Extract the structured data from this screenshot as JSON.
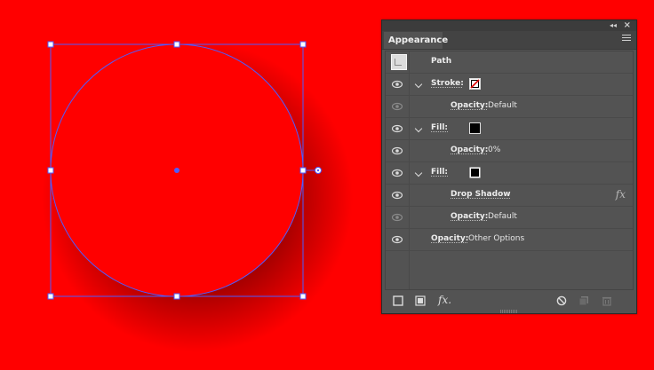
{
  "panel": {
    "title": "Appearance",
    "collapse_glyph": "◂◂",
    "close_glyph": "×",
    "menu_icon": "menu-icon"
  },
  "canvas": {
    "object": "circle",
    "fill_color": "#ff0000",
    "selection_color": "#4e5cff",
    "background_color": "#ff0000"
  },
  "rows": [
    {
      "label": "Path"
    },
    {
      "label": "Stroke:",
      "swatch": "none-red-slash"
    },
    {
      "label": "Opacity:",
      "value": "Default"
    },
    {
      "label": "Fill:",
      "swatch": "#000000"
    },
    {
      "label": "Opacity:",
      "value": "0%"
    },
    {
      "label": "Fill:",
      "swatch": "#000000"
    },
    {
      "label": "Drop Shadow",
      "icon": "fx"
    },
    {
      "label": "Opacity:",
      "value": "Default"
    },
    {
      "label": "Opacity:",
      "value": "Other Options"
    }
  ],
  "fx_glyph": "fx",
  "bottom_icons": [
    "add-stroke-icon",
    "add-fill-icon",
    "fx-menu-icon",
    "clear-appearance-icon",
    "duplicate-item-icon",
    "delete-item-icon"
  ],
  "bottom_fx_label": "fx."
}
